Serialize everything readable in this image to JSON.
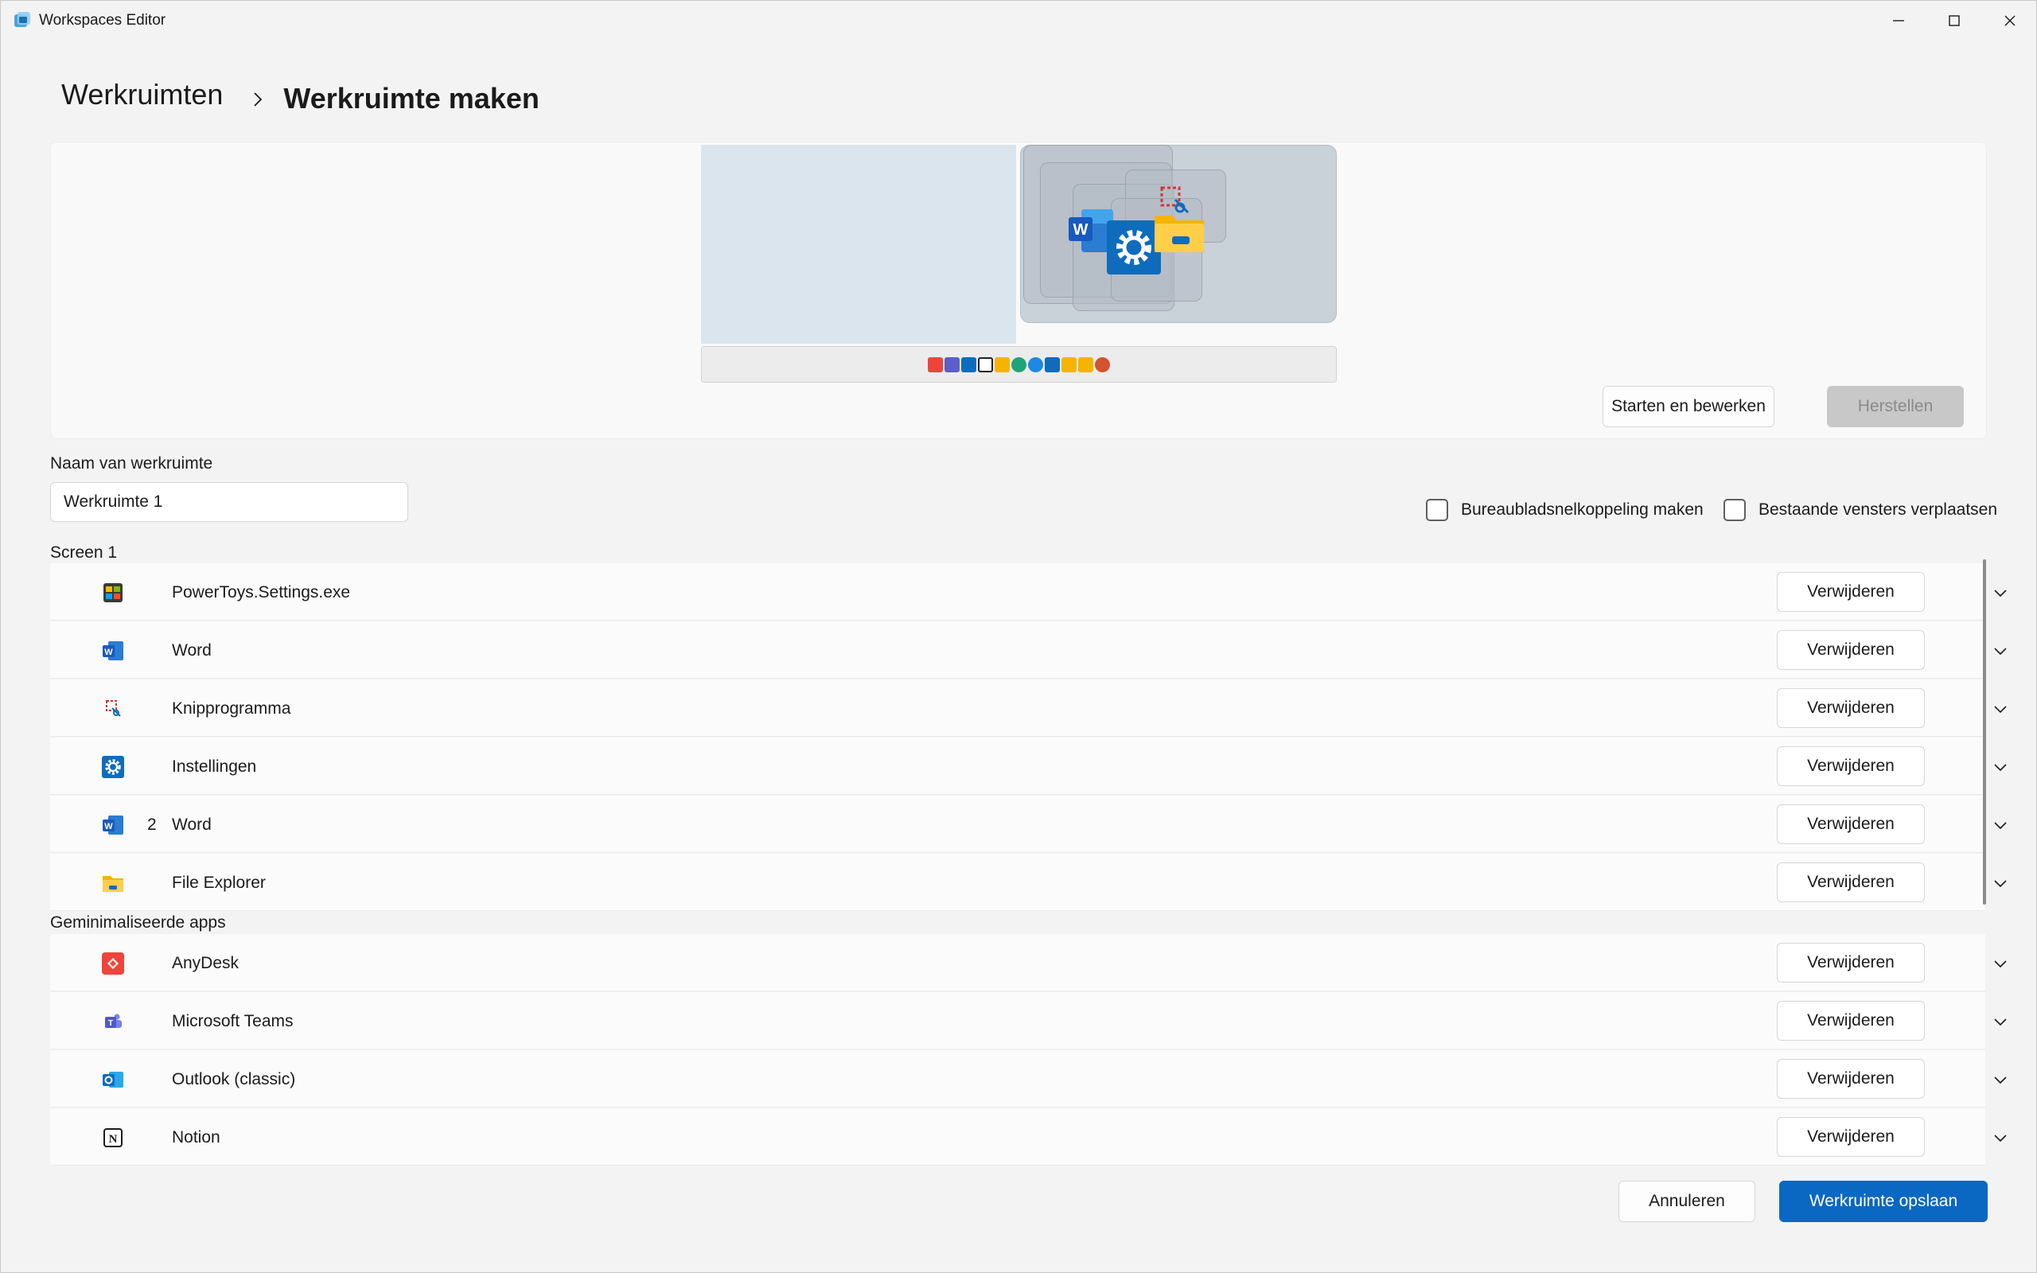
{
  "window": {
    "title": "Workspaces Editor",
    "icon": "workspaces-app-icon"
  },
  "breadcrumb": {
    "root": "Werkruimten",
    "current": "Werkruimte maken"
  },
  "preview": {
    "taskbar_icons": [
      "anydesk-icon",
      "teams-icon",
      "outlook-icon",
      "notion-icon",
      "explorer-icon",
      "edge-icon",
      "edge-icon",
      "outlook-icon",
      "explorer-icon",
      "explorer-icon",
      "powerpoint-icon"
    ],
    "launch_edit_label": "Starten en bewerken",
    "revert_label": "Herstellen"
  },
  "name_field": {
    "label": "Naam van werkruimte",
    "value": "Werkruimte 1"
  },
  "options": {
    "shortcut_label": "Bureaubladsnelkoppeling maken",
    "move_existing_label": "Bestaande vensters verplaatsen"
  },
  "screen1": {
    "label": "Screen 1",
    "apps": [
      {
        "name": "PowerToys.Settings.exe",
        "num": "",
        "icon": "powertoys-settings-icon"
      },
      {
        "name": "Word",
        "num": "",
        "icon": "word-icon"
      },
      {
        "name": "Knipprogramma",
        "num": "",
        "icon": "snipping-tool-icon"
      },
      {
        "name": "Instellingen",
        "num": "",
        "icon": "settings-gear-icon"
      },
      {
        "name": "Word",
        "num": "2",
        "icon": "word-icon"
      },
      {
        "name": "File Explorer",
        "num": "",
        "icon": "folder-icon"
      }
    ]
  },
  "minimized": {
    "label": "Geminimaliseerde apps",
    "apps": [
      {
        "name": "AnyDesk",
        "icon": "anydesk-icon"
      },
      {
        "name": "Microsoft Teams",
        "icon": "teams-icon"
      },
      {
        "name": "Outlook (classic)",
        "icon": "outlook-icon"
      },
      {
        "name": "Notion",
        "icon": "notion-icon"
      }
    ]
  },
  "row_action_label": "Verwijderen",
  "footer": {
    "cancel_label": "Annuleren",
    "save_label": "Werkruimte opslaan"
  },
  "colors": {
    "accent": "#0a67c2",
    "background": "#f3f3f3",
    "card": "#fbfbfb"
  }
}
